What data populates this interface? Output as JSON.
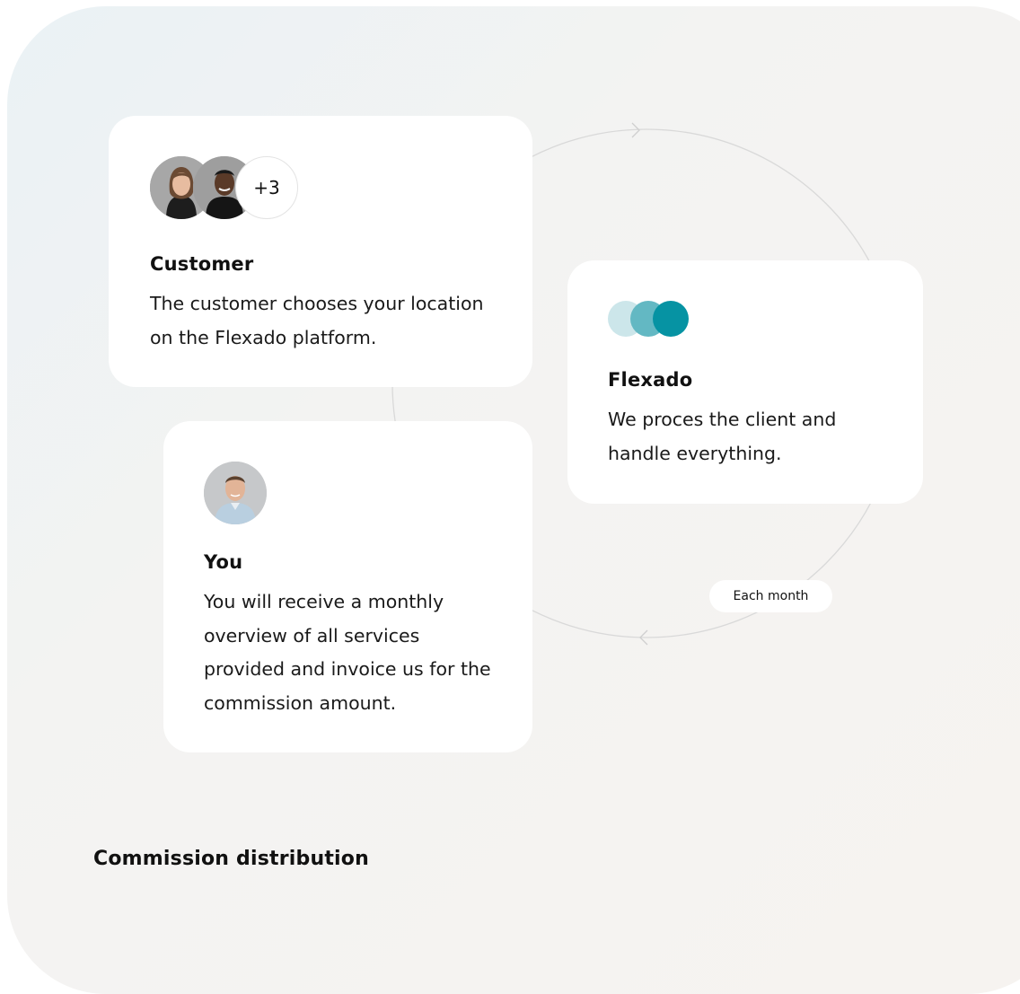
{
  "cards": {
    "customer": {
      "title": "Customer",
      "description": "The customer chooses your location on the Flexado platform.",
      "more_count": "+3",
      "avatars": [
        "woman-avatar",
        "man-avatar"
      ]
    },
    "flexado": {
      "title": "Flexado",
      "description": "We proces the client and handle everything.",
      "logo_colors": [
        "#cce6ea",
        "#63b8c3",
        "#0693a3"
      ]
    },
    "you": {
      "title": "You",
      "description": "You will receive a monthly overview of all services provided and invoice us for the commission amount.",
      "avatar": "user-avatar"
    }
  },
  "cycle": {
    "frequency_label": "Each month",
    "line_color": "#d9d9d9"
  },
  "section": {
    "title": "Commission distribution"
  }
}
